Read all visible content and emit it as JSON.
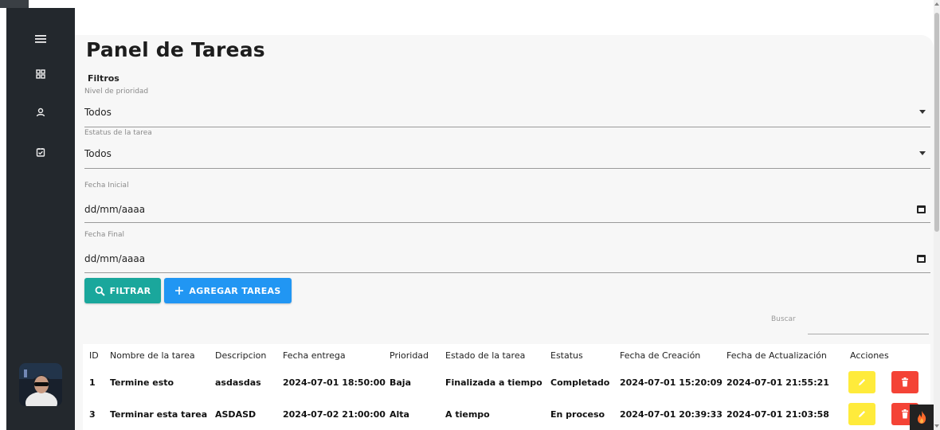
{
  "page": {
    "title": "Panel de Tareas"
  },
  "filters": {
    "label": "Filtros",
    "priority": {
      "label": "Nivel de prioridad",
      "value": "Todos"
    },
    "status": {
      "label": "Estatus de la tarea",
      "value": "Todos"
    },
    "start_date": {
      "label": "Fecha Inicial",
      "value": "dd/mm/aaaa"
    },
    "end_date": {
      "label": "Fecha Final",
      "value": "dd/mm/aaaa"
    }
  },
  "buttons": {
    "filter": "FILTRAR",
    "add": "AGREGAR TAREAS"
  },
  "search": {
    "label": "Buscar"
  },
  "table": {
    "headers": [
      "ID",
      "Nombre de la tarea",
      "Descripcion",
      "Fecha entrega",
      "Prioridad",
      "Estado de la tarea",
      "Estatus",
      "Fecha de Creación",
      "Fecha de Actualización",
      "Acciones"
    ],
    "rows": [
      [
        "1",
        "Termine esto",
        "asdasdas",
        "2024-07-01 18:50:00",
        "Baja",
        "Finalizada a tiempo",
        "Completado",
        "2024-07-01 15:20:09",
        "2024-07-01 21:55:21"
      ],
      [
        "3",
        "Terminar esta tarea",
        "ASDASD",
        "2024-07-02 21:00:00",
        "Alta",
        "A tiempo",
        "En proceso",
        "2024-07-01 20:39:33",
        "2024-07-01 21:03:58"
      ]
    ]
  },
  "colors": {
    "sidebar": "#23282d",
    "filter_button": "#1aa79c",
    "add_button": "#2196f3",
    "edit_button": "#ffeb3b",
    "delete_button": "#f44336"
  },
  "icons": {
    "nav": [
      "menu-icon",
      "dashboard-icon",
      "user-icon",
      "tasks-icon"
    ],
    "row_actions": [
      "pencil-icon",
      "trash-icon"
    ]
  }
}
